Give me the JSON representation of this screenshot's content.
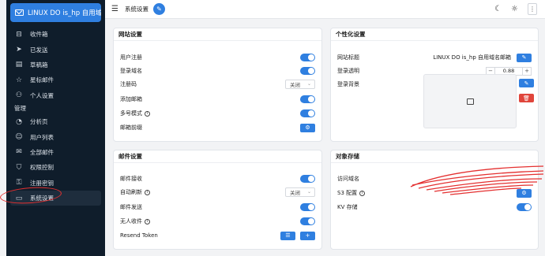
{
  "brand": {
    "title": "LINUX DO is_hp 自用域..."
  },
  "sidebar": {
    "items": [
      {
        "label": "收件箱",
        "icon": "inbox-icon"
      },
      {
        "label": "已发送",
        "icon": "send-icon"
      },
      {
        "label": "草稿箱",
        "icon": "draft-icon"
      },
      {
        "label": "星标邮件",
        "icon": "star-icon"
      },
      {
        "label": "个人设置",
        "icon": "user-settings-icon"
      }
    ],
    "group_label": "管理",
    "admin_items": [
      {
        "label": "分析页",
        "icon": "analytics-icon"
      },
      {
        "label": "用户列表",
        "icon": "users-icon"
      },
      {
        "label": "全部邮件",
        "icon": "all-mail-icon"
      },
      {
        "label": "权限控制",
        "icon": "permission-icon"
      },
      {
        "label": "注册密钥",
        "icon": "key-icon"
      },
      {
        "label": "系统设置",
        "icon": "monitor-icon"
      }
    ]
  },
  "header": {
    "title": "系统设置"
  },
  "site_settings": {
    "title": "网站设置",
    "rows": [
      {
        "label": "用户注册"
      },
      {
        "label": "登录域名"
      },
      {
        "label": "注册码",
        "value": "关闭"
      },
      {
        "label": "添加邮箱"
      },
      {
        "label": "多号模式"
      },
      {
        "label": "邮箱前缀"
      }
    ]
  },
  "personal_settings": {
    "title": "个性化设置",
    "site_title_label": "网站标题",
    "site_title_value": "LINUX DO is_hp 自用域名邮箱",
    "opacity_label": "登录透明",
    "opacity_value": "0.88",
    "background_label": "登录背景"
  },
  "mail_settings": {
    "title": "邮件设置",
    "rows": [
      {
        "label": "邮件接收"
      },
      {
        "label": "自动刷新",
        "value": "关闭"
      },
      {
        "label": "邮件发送"
      },
      {
        "label": "无人收件"
      },
      {
        "label": "Resend Token"
      }
    ]
  },
  "object_storage": {
    "title": "对象存储",
    "rows": [
      {
        "label": "访问域名"
      },
      {
        "label": "S3 配置"
      },
      {
        "label": "KV 存储"
      }
    ]
  },
  "colors": {
    "accent": "#2f7fe0",
    "sidebar_bg": "#0f1d2b",
    "danger": "#e0453b",
    "annotation": "#e43030"
  }
}
